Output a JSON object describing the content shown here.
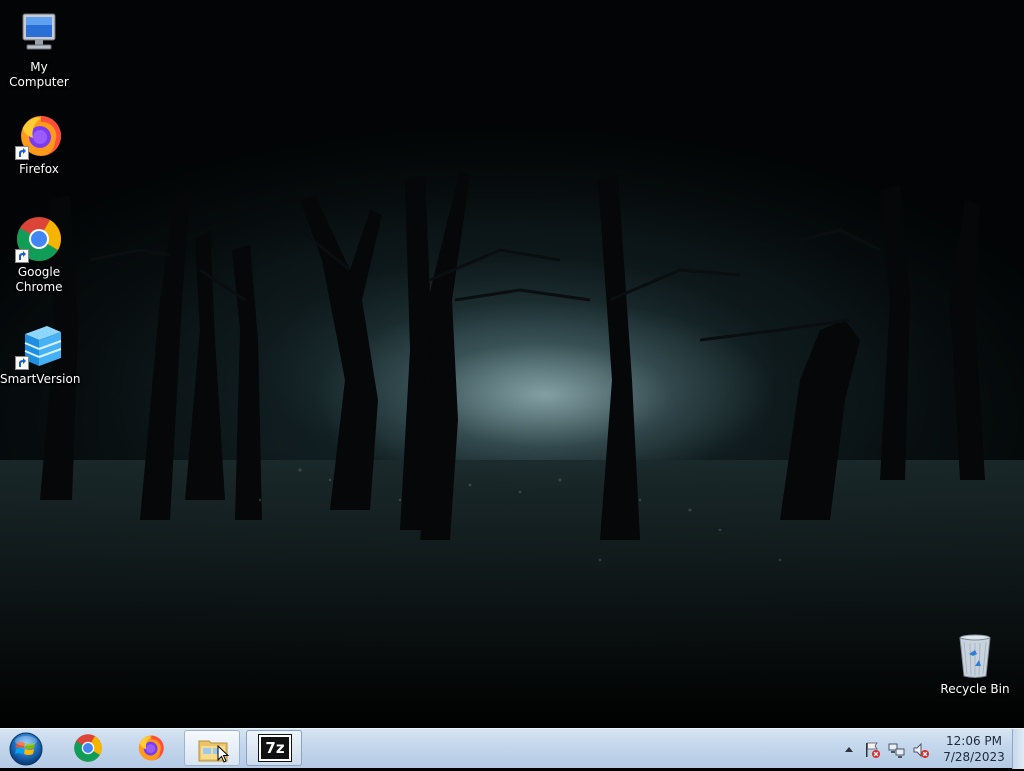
{
  "desktop": {
    "icons": [
      {
        "label": "My Computer",
        "icon": "computer-icon",
        "shortcut": false
      },
      {
        "label": "Firefox",
        "icon": "firefox-icon",
        "shortcut": true
      },
      {
        "label": "Google Chrome",
        "icon": "chrome-icon",
        "shortcut": true
      },
      {
        "label": "SmartVersion",
        "icon": "smartversion-icon",
        "shortcut": true
      },
      {
        "label": "Recycle Bin",
        "icon": "recycle-bin-icon",
        "shortcut": false
      }
    ],
    "wallpaper": "dark misty forest"
  },
  "taskbar": {
    "start_button": "windows-start-orb-icon",
    "pinned": [
      {
        "app": "Google Chrome",
        "icon": "chrome-icon",
        "state": "normal"
      },
      {
        "app": "Firefox",
        "icon": "firefox-icon",
        "state": "normal"
      },
      {
        "app": "Windows Explorer",
        "icon": "folder-icon",
        "state": "hover"
      },
      {
        "app": "7-Zip",
        "icon": "7zip-icon",
        "state": "active"
      }
    ],
    "seven_zip_glyph": "7z",
    "tray": {
      "icons": [
        "show-hidden-icons-arrow",
        "action-center-flag-icon",
        "network-icon",
        "volume-muted-icon"
      ],
      "time": "12:06 PM",
      "date": "7/28/2023"
    }
  },
  "colors": {
    "taskbar_top": "#d6e4f3",
    "taskbar_bottom": "#b5cbe5",
    "clock_text": "#1e2a3a",
    "desktop_label": "#ffffff"
  }
}
